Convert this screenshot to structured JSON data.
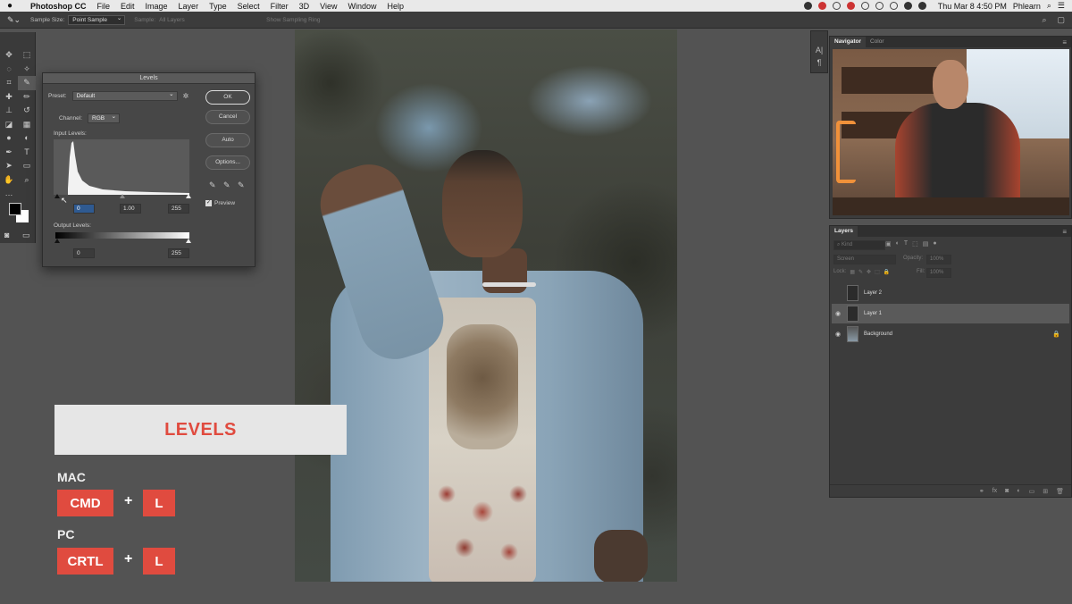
{
  "menubar": {
    "app_name": "Photoshop CC",
    "items": [
      "File",
      "Edit",
      "Image",
      "Layer",
      "Type",
      "Select",
      "Filter",
      "3D",
      "View",
      "Window",
      "Help"
    ],
    "datetime": "Thu Mar 8  4:50 PM",
    "user": "Phlearn"
  },
  "options_bar": {
    "sample_size_label": "Sample Size:",
    "sample_size_value": "Point Sample",
    "sample_label": "Sample:",
    "sample_value": "All Layers",
    "show_ring_label": "Show Sampling Ring"
  },
  "levels_dialog": {
    "title": "Levels",
    "preset_label": "Preset:",
    "preset_value": "Default",
    "channel_label": "Channel:",
    "channel_value": "RGB",
    "input_levels_label": "Input Levels:",
    "input_black": "0",
    "input_gamma": "1.00",
    "input_white": "255",
    "output_levels_label": "Output Levels:",
    "output_black": "0",
    "output_white": "255",
    "buttons": {
      "ok": "OK",
      "cancel": "Cancel",
      "auto": "Auto",
      "options": "Options..."
    },
    "preview_label": "Preview",
    "preview_checked": true
  },
  "panels": {
    "navigator_tab": "Navigator",
    "color_tab": "Color",
    "layers_tab": "Layers",
    "filter_placeholder": "Kind",
    "blend_mode": "Screen",
    "opacity_label": "Opacity:",
    "opacity_value": "100%",
    "lock_label": "Lock:",
    "fill_label": "Fill:",
    "fill_value": "100%",
    "layers": [
      {
        "name": "Layer 2",
        "visible": false,
        "selected": false,
        "locked": false
      },
      {
        "name": "Layer 1",
        "visible": true,
        "selected": true,
        "locked": false
      },
      {
        "name": "Background",
        "visible": true,
        "selected": false,
        "locked": true
      }
    ]
  },
  "overlay": {
    "banner": "LEVELS",
    "mac_label": "MAC",
    "mac_keys": [
      "CMD",
      "L"
    ],
    "pc_label": "PC",
    "pc_keys": [
      "CRTL",
      "L"
    ],
    "plus": "+"
  },
  "colors": {
    "accent_red": "#e04b3f",
    "banner_bg": "#e6e6e6",
    "ui_bg": "#535353",
    "panel_bg": "#3c3c3c"
  }
}
